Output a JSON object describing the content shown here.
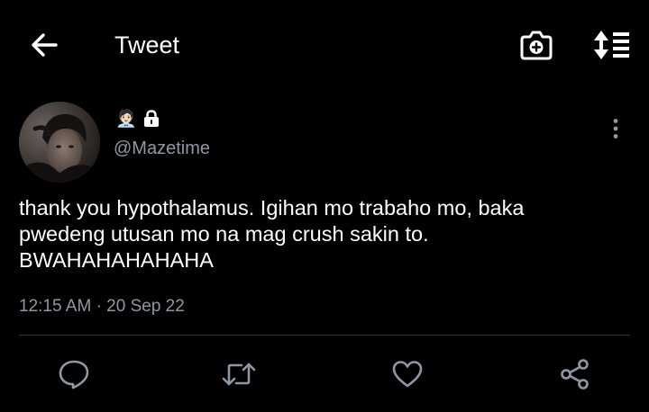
{
  "header": {
    "title": "Tweet",
    "back_icon": "arrow-left-icon",
    "camera_icon": "camera-plus-icon",
    "sort_icon": "sort-arrows-list-icon"
  },
  "author": {
    "name_emoji": "🧑🏻‍💼",
    "lock_icon": "lock-icon",
    "handle": "@Mazetime"
  },
  "tweet": {
    "lines": [
      "thank you hypothalamus. Igihan mo trabaho mo, baka",
      "pwedeng utusan mo na mag crush sakin to.",
      "BWAHAHAHAHAHA"
    ],
    "time": "12:15 AM",
    "separator": "·",
    "date": "20 Sep 22"
  },
  "actions": {
    "reply_icon": "reply-bubble-icon",
    "retweet_icon": "retweet-icon",
    "like_icon": "heart-icon",
    "share_icon": "share-icon"
  },
  "colors": {
    "background": "#000000",
    "text": "#ffffff",
    "secondary": "#8e98a3",
    "divider": "#2f3336"
  }
}
